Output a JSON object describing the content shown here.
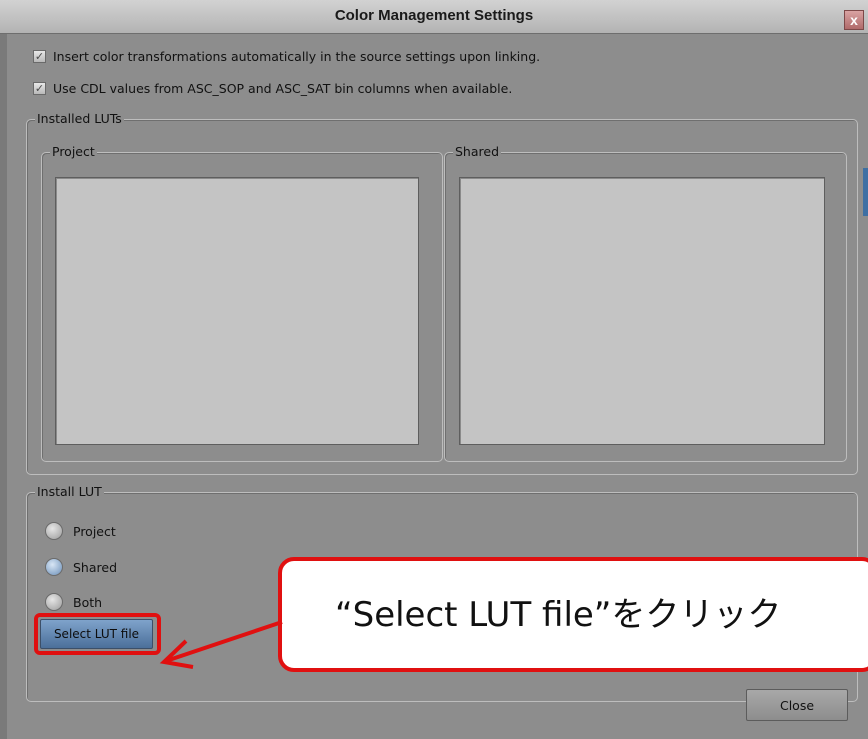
{
  "window": {
    "title": "Color Management Settings",
    "close_glyph": "x"
  },
  "options": {
    "insert_transforms": {
      "label": "Insert color transformations automatically in the source settings upon linking.",
      "checked": true
    },
    "use_cdl": {
      "label": "Use CDL values from ASC_SOP and ASC_SAT bin columns when available.",
      "checked": true
    }
  },
  "installed_luts": {
    "legend": "Installed LUTs",
    "project": {
      "legend": "Project",
      "items": []
    },
    "shared": {
      "legend": "Shared",
      "items": []
    }
  },
  "install_lut": {
    "legend": "Install LUT",
    "options": [
      {
        "label": "Project",
        "selected": false
      },
      {
        "label": "Shared",
        "selected": true
      },
      {
        "label": "Both",
        "selected": false
      }
    ],
    "select_button_label": "Select LUT file"
  },
  "footer": {
    "close_label": "Close"
  },
  "annotation": {
    "text": "“Select LUT file”をクリック",
    "color": "#e01010"
  }
}
